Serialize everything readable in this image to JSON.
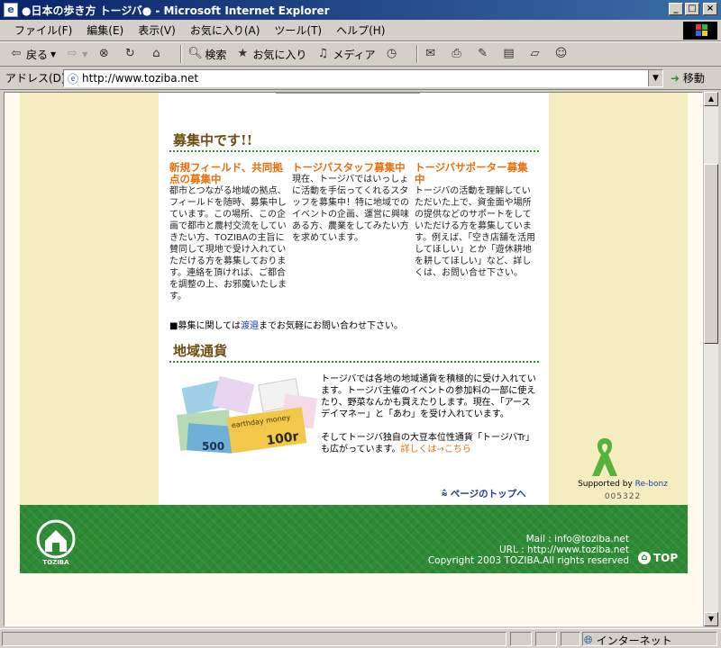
{
  "window": {
    "title": "●日本の歩き方 トージバ● - Microsoft Internet Explorer",
    "buttons": [
      "_",
      "□",
      "×"
    ]
  },
  "menubar": {
    "items": [
      "ファイル(F)",
      "編集(E)",
      "表示(V)",
      "お気に入り(A)",
      "ツール(T)",
      "ヘルプ(H)"
    ]
  },
  "toolbar": {
    "back": "戻る",
    "search": "検索",
    "favorites": "お気に入り",
    "media": "メディア"
  },
  "addressbar": {
    "label": "アドレス(D)",
    "url": "http://www.toziba.net",
    "go": "移動"
  },
  "recruit": {
    "title": "募集中です!!",
    "columns": [
      {
        "head": "新規フィールド、共同拠点の募集中",
        "body": "都市とつながる地域の拠点、フィールドを随時、募集中しています。この場所、この企画で都市と農村交流をしていきたい方、TOZIBAの主旨に賛同して現地で受け入れていただける方を募集しております。連絡を頂ければ、ご都合を調整の上、お邪魔いたします。"
      },
      {
        "head": "トージバスタッフ募集中",
        "body": "現在、トージバではいっしょに活動を手伝ってくれるスタッフを募集中！特に地域でのイベントの企画、運営に興味ある方、農業をしてみたい方を求めています。"
      },
      {
        "head": "トージバサポーター募集中",
        "body": "トージバの活動を理解していただいた上で、資金面や場所の提供などのサポートをしていただける方を募集しています。例えば、「空き店舗を活用してほしい」とか「遊休耕地を耕してほしい」など、詳しくは、お問い合せ下さい。"
      }
    ],
    "note_prefix": "■募集に関しては",
    "note_link": "渡邉",
    "note_suffix": "までお気軽にお問い合わせ下さい。"
  },
  "currency": {
    "title": "地域通貨",
    "text1": "トージバでは各地の地域通貨を積極的に受け入れています。トージバ主催のイベントの参加料の一部に使えたり、野菜なんかも買えたりします。現在、「アースデイマネー」と「あわ」を受け入れています。",
    "text2": "そしてトージバ独自の大豆本位性通貨「トージバTr」も広がっています。",
    "link": "詳しくは→こちら",
    "bill_text": "earthday money",
    "bill_values": [
      "500",
      "100r"
    ]
  },
  "pagetop": "ページのトップへ",
  "sidebar": {
    "supported_prefix": "Supported by ",
    "supported_link": "Re-bonz",
    "counter": "005322"
  },
  "footer": {
    "logo_text": "TOZIBA",
    "mail": "Mail : info@toziba.net",
    "url": "URL : http://www.toziba.net",
    "copyright": "Copyright 2003 TOZIBA.All rights reserved",
    "top": "TOP"
  },
  "statusbar": {
    "zone": "インターネット"
  },
  "colors": {
    "accent_orange": "#e8700e",
    "section_brown": "#6b4e12",
    "footer_green": "#2e8b35",
    "side_cream": "#f5ecc0"
  }
}
